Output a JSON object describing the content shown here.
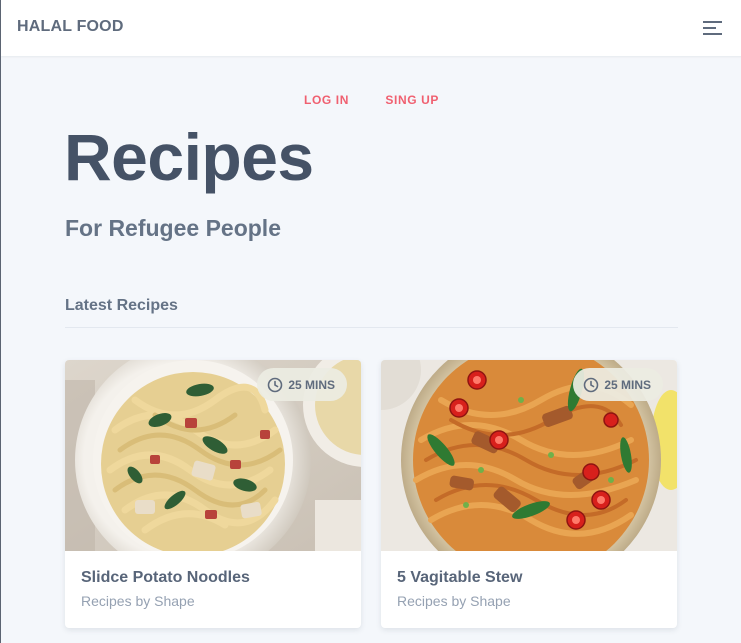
{
  "header": {
    "brand": "HALAL FOOD",
    "menu_icon": "hamburger-menu-icon"
  },
  "auth": {
    "login_label": "LOG IN",
    "signup_label": "SING UP"
  },
  "hero": {
    "title": "Recipes",
    "subtitle": "For Refugee People"
  },
  "section": {
    "title": "Latest Recipes"
  },
  "recipes": [
    {
      "title": "Slidce Potato Noodles",
      "author": "Recipes by Shape",
      "time": "25 MINS",
      "image": "fettuccine-pasta-bowl-photo"
    },
    {
      "title": "5 Vagitable Stew",
      "author": "Recipes by Shape",
      "time": "25 MINS",
      "image": "stir-fry-noodles-bowl-photo"
    }
  ],
  "colors": {
    "accent": "#f06070",
    "heading": "#455266",
    "text": "#657386",
    "muted": "#95a1b2",
    "background": "#f4f7fb"
  }
}
